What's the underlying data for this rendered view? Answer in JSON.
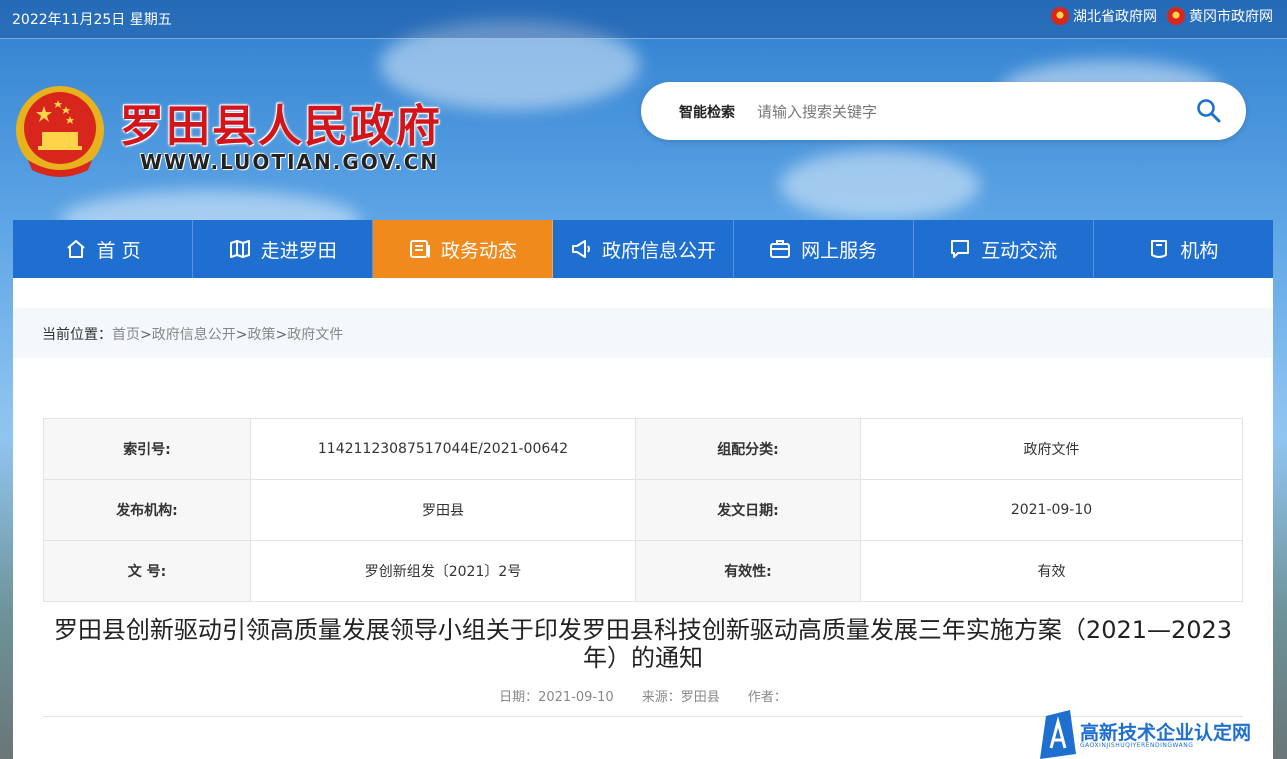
{
  "topbar": {
    "date": "2022年11月25日 星期五",
    "links": [
      "湖北省政府网",
      "黄冈市政府网"
    ]
  },
  "header": {
    "site_name": "罗田县人民政府",
    "site_url": "WWW.LUOTIAN.GOV.CN"
  },
  "search": {
    "label": "智能检索",
    "placeholder": "请输入搜索关键字"
  },
  "nav": {
    "items": [
      {
        "label": "首 页",
        "icon": "home-icon"
      },
      {
        "label": "走进罗田",
        "icon": "map-icon"
      },
      {
        "label": "政务动态",
        "icon": "news-icon",
        "active": true
      },
      {
        "label": "政府信息公开",
        "icon": "megaphone-icon"
      },
      {
        "label": "网上服务",
        "icon": "briefcase-icon"
      },
      {
        "label": "互动交流",
        "icon": "chat-icon"
      },
      {
        "label": "机构",
        "icon": "building-icon"
      }
    ]
  },
  "breadcrumb": {
    "prefix": "当前位置：",
    "items": [
      "首页",
      "政府信息公开",
      "政策",
      "政府文件"
    ],
    "sep": ">"
  },
  "meta_table": {
    "rows": [
      [
        {
          "k": "索引号:",
          "v": "11421123087517044E/2021-00642"
        },
        {
          "k": "组配分类:",
          "v": "政府文件"
        }
      ],
      [
        {
          "k": "发布机构:",
          "v": "罗田县"
        },
        {
          "k": "发文日期:",
          "v": "2021-09-10"
        }
      ],
      [
        {
          "k": "文 号:",
          "v": "罗创新组发〔2021〕2号"
        },
        {
          "k": "有效性:",
          "v": "有效"
        }
      ]
    ]
  },
  "article": {
    "title": "罗田县创新驱动引领高质量发展领导小组关于印发罗田县科技创新驱动高质量发展三年实施方案（2021—2023年）的通知",
    "date": "日期：2021-09-10",
    "source": "来源：罗田县",
    "author": "作者："
  },
  "watermark": {
    "text": "高新技术企业认定网",
    "sub": "GAOXINJISHUQIYERENDINGWANG"
  },
  "colors": {
    "nav_bg": "#1f6fd0",
    "nav_active": "#f08a1c",
    "brand_red": "#d4141b"
  }
}
